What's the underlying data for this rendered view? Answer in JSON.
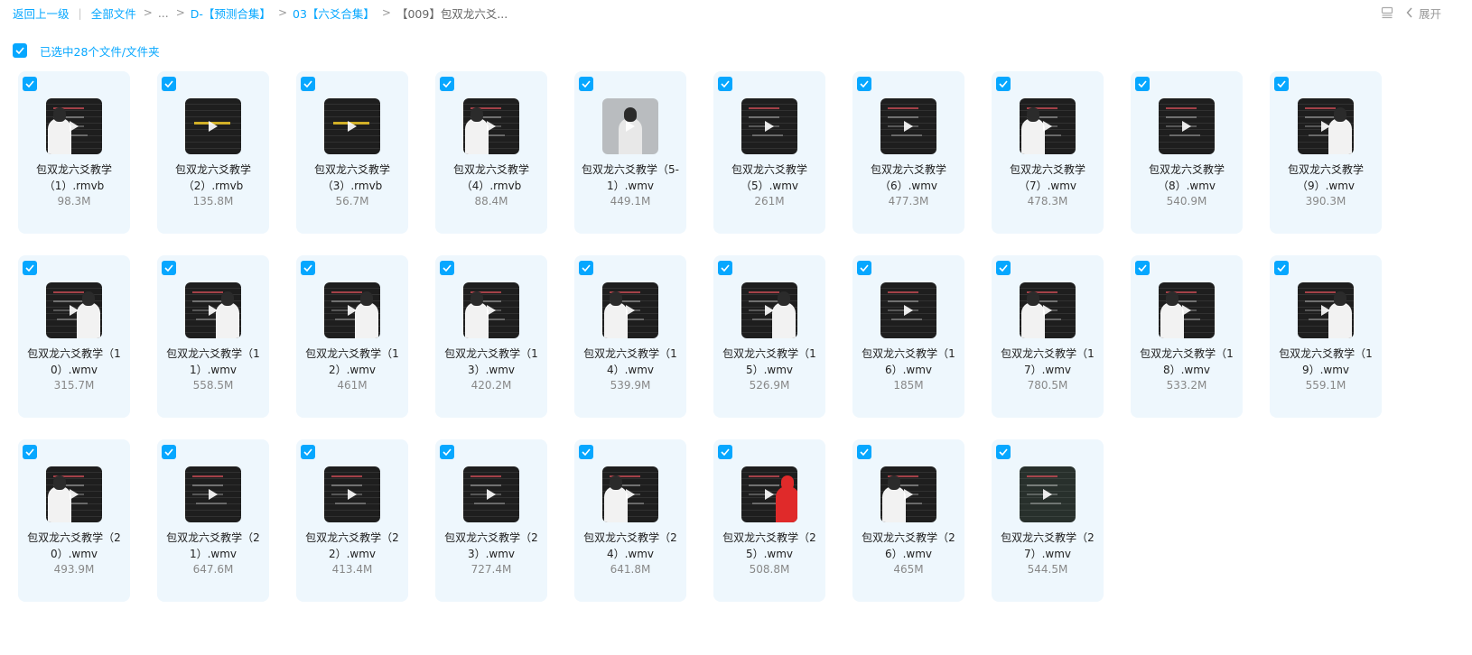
{
  "breadcrumb": {
    "back": "返回上一级",
    "separator": "|",
    "root": "全部文件",
    "ellipsis": "...",
    "level1": "D-【预测合集】",
    "level2": "03【六爻合集】",
    "current": "【009】包双龙六爻..."
  },
  "toolbar": {
    "expand_label": "展开"
  },
  "selection": {
    "text": "已选中28个文件/文件夹"
  },
  "colors": {
    "accent": "#06a7ff",
    "card_bg": "#eef7fd"
  },
  "files": [
    {
      "name": "包双龙六爻教学（1）.rmvb",
      "size": "98.3M",
      "thumb": "left",
      "checked": true
    },
    {
      "name": "包双龙六爻教学（2）.rmvb",
      "size": "135.8M",
      "thumb": "yellow",
      "checked": true
    },
    {
      "name": "包双龙六爻教学（3）.rmvb",
      "size": "56.7M",
      "thumb": "yellow",
      "checked": true
    },
    {
      "name": "包双龙六爻教学（4）.rmvb",
      "size": "88.4M",
      "thumb": "left",
      "checked": true
    },
    {
      "name": "包双龙六爻教学（5-1）.wmv",
      "size": "449.1M",
      "thumb": "grey",
      "checked": true
    },
    {
      "name": "包双龙六爻教学（5）.wmv",
      "size": "261M",
      "thumb": "board",
      "checked": true
    },
    {
      "name": "包双龙六爻教学（6）.wmv",
      "size": "477.3M",
      "thumb": "board",
      "checked": true
    },
    {
      "name": "包双龙六爻教学（7）.wmv",
      "size": "478.3M",
      "thumb": "left",
      "checked": true
    },
    {
      "name": "包双龙六爻教学（8）.wmv",
      "size": "540.9M",
      "thumb": "board",
      "checked": true
    },
    {
      "name": "包双龙六爻教学（9）.wmv",
      "size": "390.3M",
      "thumb": "right",
      "checked": true
    },
    {
      "name": "包双龙六爻教学（10）.wmv",
      "size": "315.7M",
      "thumb": "right",
      "checked": true
    },
    {
      "name": "包双龙六爻教学（11）.wmv",
      "size": "558.5M",
      "thumb": "right",
      "checked": true
    },
    {
      "name": "包双龙六爻教学（12）.wmv",
      "size": "461M",
      "thumb": "right",
      "checked": true
    },
    {
      "name": "包双龙六爻教学（13）.wmv",
      "size": "420.2M",
      "thumb": "left",
      "checked": true
    },
    {
      "name": "包双龙六爻教学（14）.wmv",
      "size": "539.9M",
      "thumb": "left",
      "checked": true
    },
    {
      "name": "包双龙六爻教学（15）.wmv",
      "size": "526.9M",
      "thumb": "right",
      "checked": true
    },
    {
      "name": "包双龙六爻教学（16）.wmv",
      "size": "185M",
      "thumb": "board",
      "checked": true
    },
    {
      "name": "包双龙六爻教学（17）.wmv",
      "size": "780.5M",
      "thumb": "left",
      "checked": true
    },
    {
      "name": "包双龙六爻教学（18）.wmv",
      "size": "533.2M",
      "thumb": "left",
      "checked": true
    },
    {
      "name": "包双龙六爻教学（19）.wmv",
      "size": "559.1M",
      "thumb": "right",
      "checked": true
    },
    {
      "name": "包双龙六爻教学（20）.wmv",
      "size": "493.9M",
      "thumb": "left",
      "checked": true
    },
    {
      "name": "包双龙六爻教学（21）.wmv",
      "size": "647.6M",
      "thumb": "board",
      "checked": true
    },
    {
      "name": "包双龙六爻教学（22）.wmv",
      "size": "413.4M",
      "thumb": "board",
      "checked": true
    },
    {
      "name": "包双龙六爻教学（23）.wmv",
      "size": "727.4M",
      "thumb": "board",
      "checked": true
    },
    {
      "name": "包双龙六爻教学（24）.wmv",
      "size": "641.8M",
      "thumb": "left",
      "checked": true
    },
    {
      "name": "包双龙六爻教学（25）.wmv",
      "size": "508.8M",
      "thumb": "red",
      "checked": true
    },
    {
      "name": "包双龙六爻教学（26）.wmv",
      "size": "465M",
      "thumb": "left",
      "checked": true
    },
    {
      "name": "包双龙六爻教学（27）.wmv",
      "size": "544.5M",
      "thumb": "green",
      "checked": true
    }
  ]
}
